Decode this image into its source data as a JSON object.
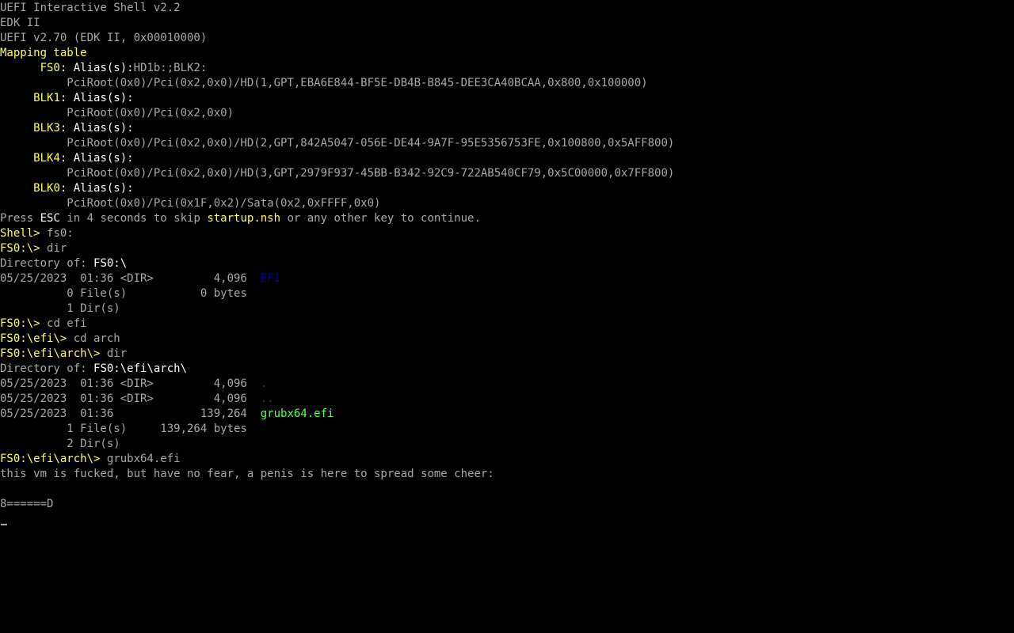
{
  "window": {
    "title": "UEFI Interactive Shell v2.2"
  },
  "colors": {
    "background": "#000000",
    "gray": "#a8a8a8",
    "white": "#ffffff",
    "yellow": "#ffff55",
    "blue": "#0000a8",
    "green": "#55ff55",
    "dim": "#3a3a3a"
  },
  "terminal": {
    "lines": [
      {
        "name": "shell-banner",
        "segments": [
          {
            "text": "UEFI Interactive Shell v2.2",
            "color": "gray"
          }
        ]
      },
      {
        "name": "edk-banner",
        "segments": [
          {
            "text": "EDK II",
            "color": "gray"
          }
        ]
      },
      {
        "name": "uefi-version",
        "segments": [
          {
            "text": "UEFI v2.70 (EDK II, 0x00010000)",
            "color": "gray"
          }
        ]
      },
      {
        "name": "mapping-table-header",
        "segments": [
          {
            "text": "Mapping table",
            "color": "yellow"
          }
        ]
      },
      {
        "name": "map-fs0-alias",
        "segments": [
          {
            "text": "      ",
            "color": "gray"
          },
          {
            "text": "FS0",
            "color": "yellow"
          },
          {
            "text": ": Alias(s):",
            "color": "white"
          },
          {
            "text": "HD1b:;BLK2:",
            "color": "gray"
          }
        ]
      },
      {
        "name": "map-fs0-path",
        "segments": [
          {
            "text": "          PciRoot(0x0)/Pci(0x2,0x0)/HD(1,GPT,EBA6E844-BF5E-DB4B-B845-DEE3CA40BCAA,0x800,0x100000)",
            "color": "gray"
          }
        ]
      },
      {
        "name": "map-blk1-alias",
        "segments": [
          {
            "text": "     ",
            "color": "gray"
          },
          {
            "text": "BLK1",
            "color": "yellow"
          },
          {
            "text": ": Alias(s):",
            "color": "white"
          }
        ]
      },
      {
        "name": "map-blk1-path",
        "segments": [
          {
            "text": "          PciRoot(0x0)/Pci(0x2,0x0)",
            "color": "gray"
          }
        ]
      },
      {
        "name": "map-blk3-alias",
        "segments": [
          {
            "text": "     ",
            "color": "gray"
          },
          {
            "text": "BLK3",
            "color": "yellow"
          },
          {
            "text": ": Alias(s):",
            "color": "white"
          }
        ]
      },
      {
        "name": "map-blk3-path",
        "segments": [
          {
            "text": "          PciRoot(0x0)/Pci(0x2,0x0)/HD(2,GPT,842A5047-056E-DE44-9A7F-95E5356753FE,0x100800,0x5AFF800)",
            "color": "gray"
          }
        ]
      },
      {
        "name": "map-blk4-alias",
        "segments": [
          {
            "text": "     ",
            "color": "gray"
          },
          {
            "text": "BLK4",
            "color": "yellow"
          },
          {
            "text": ": Alias(s):",
            "color": "white"
          }
        ]
      },
      {
        "name": "map-blk4-path",
        "segments": [
          {
            "text": "          PciRoot(0x0)/Pci(0x2,0x0)/HD(3,GPT,2979F937-45BB-B342-92C9-722AB540CF79,0x5C00000,0x7FF800)",
            "color": "gray"
          }
        ]
      },
      {
        "name": "map-blk0-alias",
        "segments": [
          {
            "text": "     ",
            "color": "gray"
          },
          {
            "text": "BLK0",
            "color": "yellow"
          },
          {
            "text": ": Alias(s):",
            "color": "white"
          }
        ]
      },
      {
        "name": "map-blk0-path",
        "segments": [
          {
            "text": "          PciRoot(0x0)/Pci(0x1F,0x2)/Sata(0x2,0xFFFF,0x0)",
            "color": "gray"
          }
        ]
      },
      {
        "name": "startup-prompt",
        "segments": [
          {
            "text": "Press ",
            "color": "gray"
          },
          {
            "text": "ESC",
            "color": "white"
          },
          {
            "text": " in 4 seconds to skip ",
            "color": "gray"
          },
          {
            "text": "startup.nsh",
            "color": "yellow"
          },
          {
            "text": " or any other key to continue.",
            "color": "gray"
          }
        ]
      },
      {
        "name": "cmd-fs0",
        "segments": [
          {
            "text": "Shell> ",
            "color": "yellow"
          },
          {
            "text": "fs0:",
            "color": "gray"
          }
        ]
      },
      {
        "name": "cmd-dir-root",
        "segments": [
          {
            "text": "FS0:\\> ",
            "color": "yellow"
          },
          {
            "text": "dir",
            "color": "gray"
          }
        ]
      },
      {
        "name": "dir-header-root",
        "segments": [
          {
            "text": "Directory of: ",
            "color": "gray"
          },
          {
            "text": "FS0:\\",
            "color": "white"
          }
        ]
      },
      {
        "name": "dir-entry-efi",
        "segments": [
          {
            "text": "05/25/2023  01:36 <DIR>         4,096  ",
            "color": "gray"
          },
          {
            "text": "EFI",
            "color": "blue"
          }
        ]
      },
      {
        "name": "dir-files-root",
        "segments": [
          {
            "text": "          0 File(s)           0 bytes",
            "color": "gray"
          }
        ]
      },
      {
        "name": "dir-dirs-root",
        "segments": [
          {
            "text": "          1 Dir(s)",
            "color": "gray"
          }
        ]
      },
      {
        "name": "cmd-cd-efi",
        "segments": [
          {
            "text": "FS0:\\> ",
            "color": "yellow"
          },
          {
            "text": "cd efi",
            "color": "gray"
          }
        ]
      },
      {
        "name": "cmd-cd-arch",
        "segments": [
          {
            "text": "FS0:\\efi\\> ",
            "color": "yellow"
          },
          {
            "text": "cd arch",
            "color": "gray"
          }
        ]
      },
      {
        "name": "cmd-dir-arch",
        "segments": [
          {
            "text": "FS0:\\efi\\arch\\> ",
            "color": "yellow"
          },
          {
            "text": "dir",
            "color": "gray"
          }
        ]
      },
      {
        "name": "dir-header-arch",
        "segments": [
          {
            "text": "Directory of: ",
            "color": "gray"
          },
          {
            "text": "FS0:\\efi\\arch\\",
            "color": "white"
          }
        ]
      },
      {
        "name": "dir-entry-dot",
        "segments": [
          {
            "text": "05/25/2023  01:36 <DIR>         4,096  ",
            "color": "gray"
          },
          {
            "text": ".",
            "color": "dim"
          }
        ]
      },
      {
        "name": "dir-entry-dotdot",
        "segments": [
          {
            "text": "05/25/2023  01:36 <DIR>         4,096  ",
            "color": "gray"
          },
          {
            "text": "..",
            "color": "dim"
          }
        ]
      },
      {
        "name": "dir-entry-grubx64",
        "segments": [
          {
            "text": "05/25/2023  01:36             139,264  ",
            "color": "gray"
          },
          {
            "text": "grubx64.efi",
            "color": "green"
          }
        ]
      },
      {
        "name": "dir-files-arch",
        "segments": [
          {
            "text": "          1 File(s)     139,264 bytes",
            "color": "gray"
          }
        ]
      },
      {
        "name": "dir-dirs-arch",
        "segments": [
          {
            "text": "          2 Dir(s)",
            "color": "gray"
          }
        ]
      },
      {
        "name": "cmd-run-grubx64",
        "segments": [
          {
            "text": "FS0:\\efi\\arch\\> ",
            "color": "yellow"
          },
          {
            "text": "grubx64.efi",
            "color": "gray"
          }
        ]
      },
      {
        "name": "program-output-message",
        "segments": [
          {
            "text": "this vm is fucked, but have no fear, a penis is here to spread some cheer:",
            "color": "gray"
          }
        ]
      },
      {
        "name": "blank-line",
        "segments": [
          {
            "text": "",
            "color": "gray"
          }
        ]
      },
      {
        "name": "program-output-ascii",
        "segments": [
          {
            "text": "8======D",
            "color": "gray"
          }
        ]
      }
    ]
  }
}
